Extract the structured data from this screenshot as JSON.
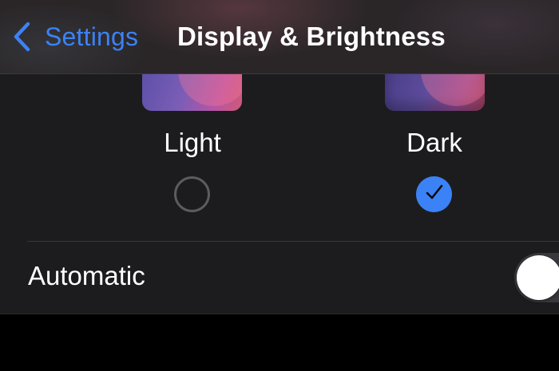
{
  "nav": {
    "back_label": "Settings",
    "title": "Display & Brightness"
  },
  "appearance": {
    "options": [
      {
        "label": "Light",
        "selected": false
      },
      {
        "label": "Dark",
        "selected": true
      }
    ]
  },
  "automatic": {
    "label": "Automatic",
    "enabled": false
  },
  "colors": {
    "accent": "#3b82f6",
    "background": "#000000",
    "card": "#1c1c1e",
    "toggle_off": "#39393d"
  },
  "icons": [
    "chevron-left-icon",
    "checkmark-icon"
  ]
}
